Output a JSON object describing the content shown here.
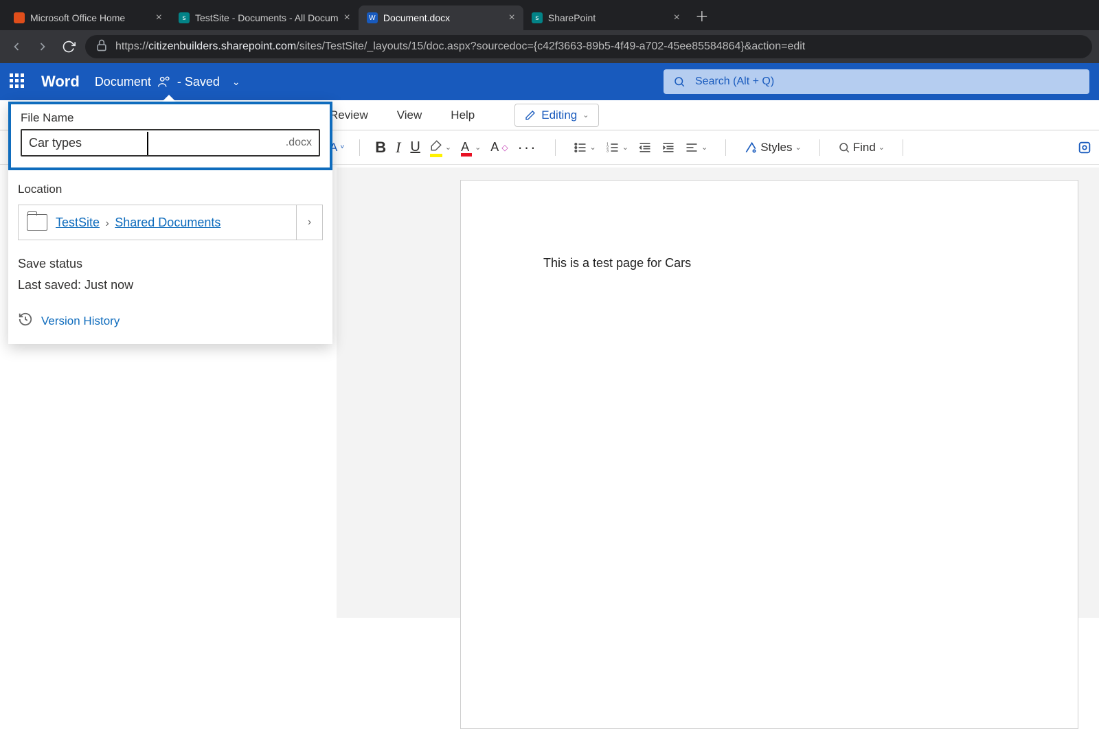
{
  "browser": {
    "tabs": [
      {
        "title": "Microsoft Office Home",
        "favcolor": "#e04e1b"
      },
      {
        "title": "TestSite - Documents - All Docum",
        "favcolor": "#038387"
      },
      {
        "title": "Document.docx",
        "favcolor": "#185abd"
      },
      {
        "title": "SharePoint",
        "favcolor": "#038387"
      }
    ],
    "url_prefix": "https://",
    "url_host": "citizenbuilders.sharepoint.com",
    "url_path": "/sites/TestSite/_layouts/15/doc.aspx?sourcedoc={c42f3663-89b5-4f49-a702-45ee85584864}&action=edit"
  },
  "word_header": {
    "app_name": "Word",
    "doc_name": "Document",
    "saved_suffix": "- Saved",
    "search_placeholder": "Search (Alt + Q)"
  },
  "ribbon": {
    "tabs": [
      "Review",
      "View",
      "Help"
    ],
    "editing_label": "Editing"
  },
  "toolbar": {
    "styles_label": "Styles",
    "find_label": "Find"
  },
  "popover": {
    "file_name_label": "File Name",
    "file_name_value": "Car types",
    "file_ext": ".docx",
    "location_label": "Location",
    "breadcrumb_a": "TestSite",
    "breadcrumb_b": "Shared Documents",
    "save_status_label": "Save status",
    "save_status_value": "Last saved: Just now",
    "version_history": "Version History"
  },
  "document": {
    "body_text": "This is a test page for Cars"
  }
}
